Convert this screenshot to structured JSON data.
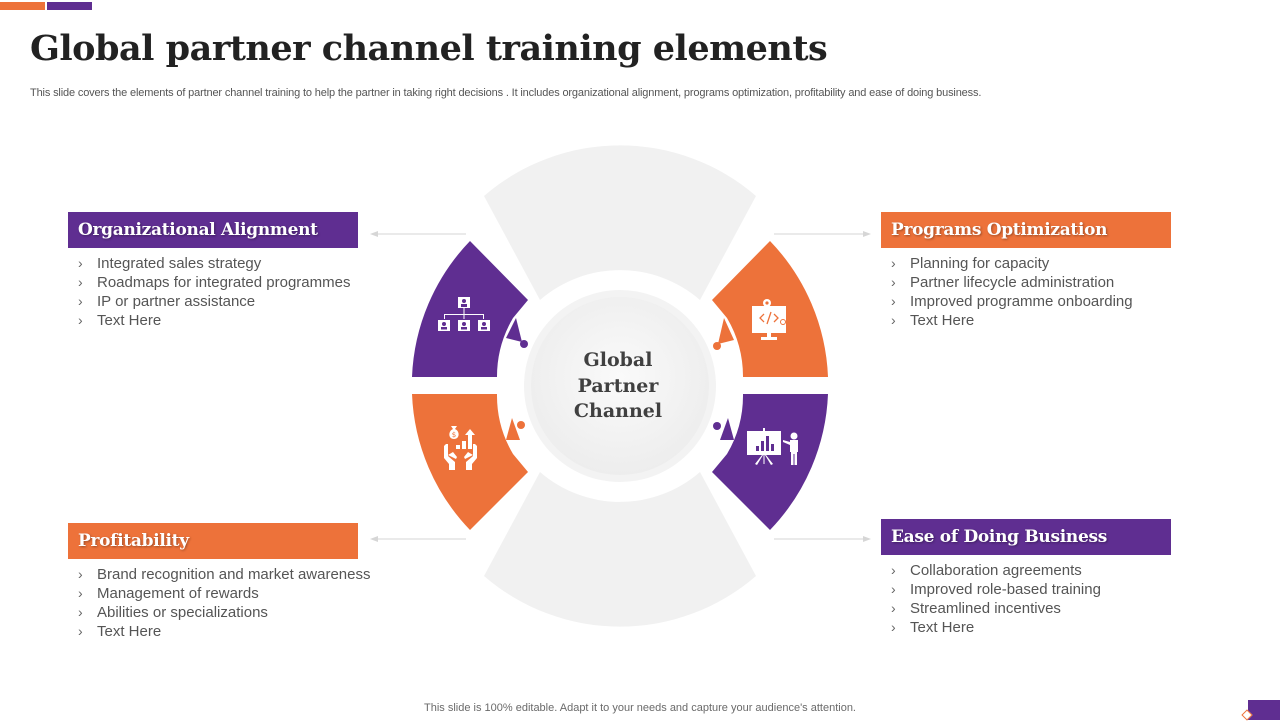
{
  "slide": {
    "title": "Global partner channel training elements",
    "subtitle": "This slide covers the elements of partner channel training to help the partner in taking right decisions . It includes organizational alignment, programs optimization, profitability and ease of doing business.",
    "footer": "This slide is 100% editable. Adapt it to your needs and capture your audience's attention."
  },
  "colors": {
    "purple": "#5F2E91",
    "orange": "#ED723A",
    "ring_grey": "#F1F1F1",
    "text": "#555555"
  },
  "center": {
    "lines": [
      "Global",
      "Partner",
      "Channel"
    ]
  },
  "bullet_glyph": "›",
  "sections": [
    {
      "id": "organizational-alignment",
      "title": "Organizational Alignment",
      "color": "purple",
      "icon": "org-chart-icon",
      "items": [
        "Integrated sales strategy",
        "Roadmaps for integrated programmes",
        "IP or partner assistance",
        "Text Here"
      ]
    },
    {
      "id": "programs-optimization",
      "title": "Programs Optimization",
      "color": "orange",
      "icon": "monitor-code-icon",
      "items": [
        "Planning for capacity",
        "Partner lifecycle administration",
        "Improved programme onboarding",
        "Text Here"
      ]
    },
    {
      "id": "profitability",
      "title": "Profitability",
      "color": "orange",
      "icon": "money-growth-hands-icon",
      "items": [
        "Brand recognition and market awareness",
        "Management of rewards",
        "Abilities or specializations",
        "Text Here"
      ]
    },
    {
      "id": "ease-of-doing-business",
      "title": "Ease of Doing Business",
      "color": "purple",
      "icon": "presentation-board-icon",
      "items": [
        "Collaboration agreements",
        "Improved role-based training",
        "Streamlined incentives",
        "Text Here"
      ]
    }
  ]
}
